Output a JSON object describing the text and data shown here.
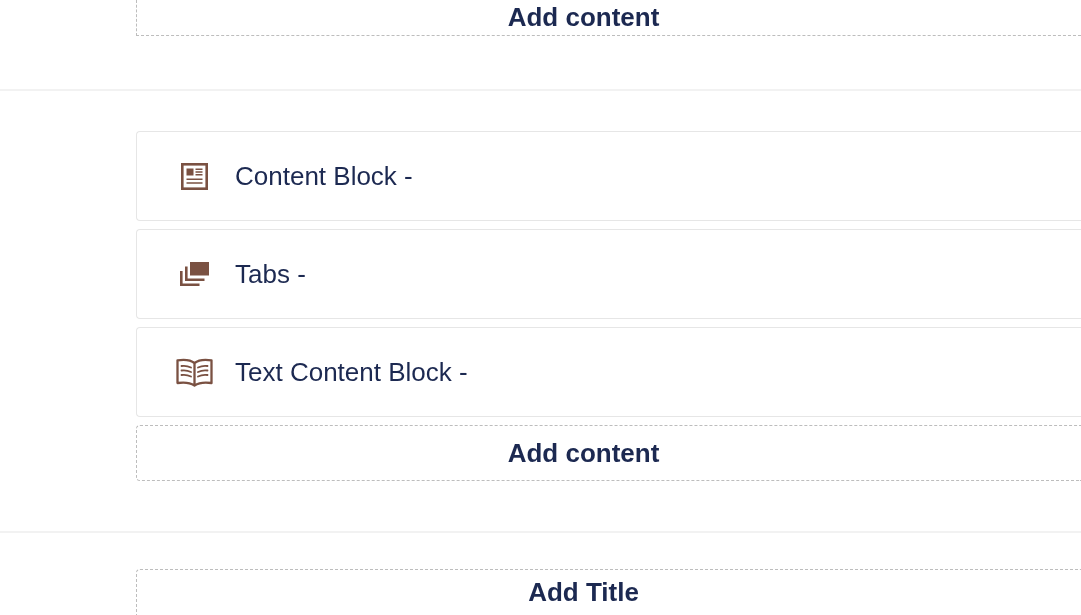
{
  "sections": [
    {
      "add_button": {
        "label": "Add content"
      }
    },
    {
      "items": [
        {
          "kind": "content-block",
          "label": "Content Block -"
        },
        {
          "kind": "tabs",
          "label": "Tabs -"
        },
        {
          "kind": "text-content-block",
          "label": "Text Content Block -"
        }
      ],
      "add_button": {
        "label": "Add content"
      }
    },
    {
      "add_button": {
        "label": "Add Title"
      }
    }
  ]
}
